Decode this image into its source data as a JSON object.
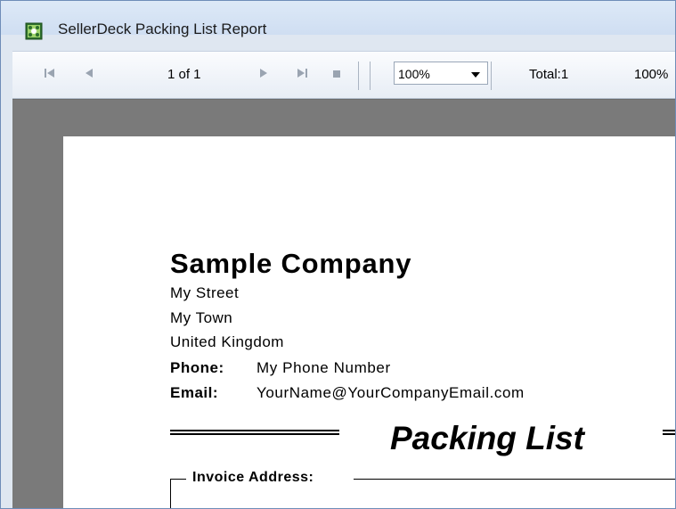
{
  "window": {
    "title": "SellerDeck Packing List Report"
  },
  "toolbar": {
    "page_counter": "1 of 1",
    "zoom_value": "100%",
    "total": "Total:1",
    "percent": "100%"
  },
  "report": {
    "company_name": "Sample Company",
    "address_lines": [
      "My Street",
      "My Town",
      "United Kingdom"
    ],
    "phone_label": "Phone:",
    "phone_value": "My Phone Number",
    "email_label": "Email:",
    "email_value": "YourName@YourCompanyEmail.com",
    "title": "Packing List",
    "invoice_address_label": "Invoice Address:"
  },
  "icons": {
    "app": "sellerdeck-app-icon",
    "first": "first-page-icon",
    "prev": "previous-page-icon",
    "next": "next-page-icon",
    "last": "last-page-icon",
    "stop": "stop-icon"
  }
}
